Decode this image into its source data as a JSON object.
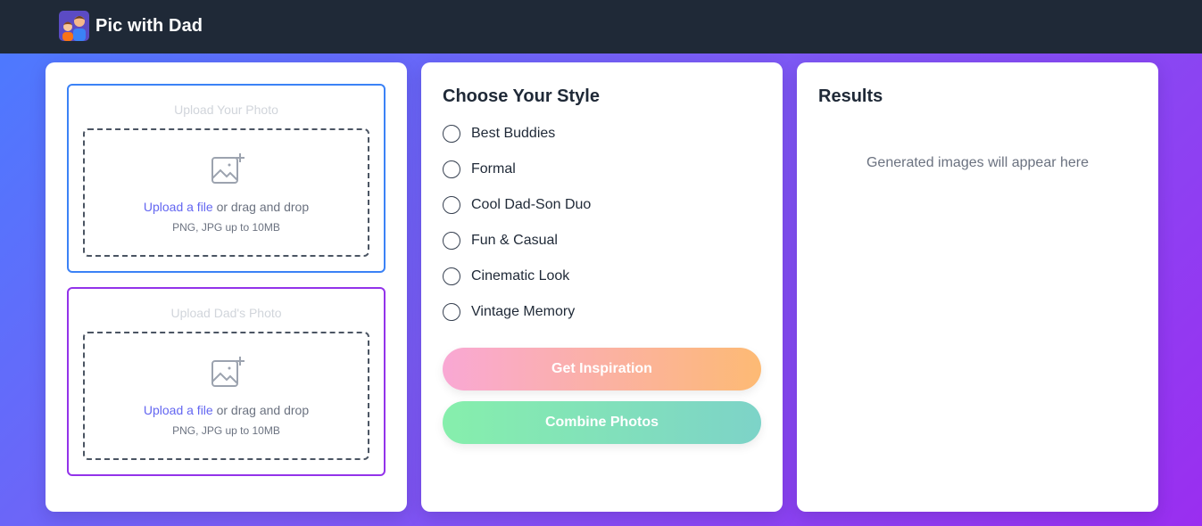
{
  "app": {
    "title": "Pic with Dad",
    "logo_icon": "dad-and-son-logo-icon"
  },
  "upload": {
    "your_photo": {
      "title": "Upload Your Photo",
      "link": "Upload a file",
      "text": " or drag and drop",
      "hint": "PNG, JPG up to 10MB",
      "icon": "image-add-icon",
      "border_color": "#3b82f6"
    },
    "dad_photo": {
      "title": "Upload Dad's Photo",
      "link": "Upload a file",
      "text": " or drag and drop",
      "hint": "PNG, JPG up to 10MB",
      "icon": "image-add-icon",
      "border_color": "#9333ea"
    }
  },
  "style": {
    "title": "Choose Your Style",
    "options": [
      {
        "label": "Best Buddies",
        "selected": false
      },
      {
        "label": "Formal",
        "selected": false
      },
      {
        "label": "Cool Dad-Son Duo",
        "selected": false
      },
      {
        "label": "Fun & Casual",
        "selected": false
      },
      {
        "label": "Cinematic Look",
        "selected": false
      },
      {
        "label": "Vintage Memory",
        "selected": false
      }
    ],
    "inspire_button": "Get Inspiration",
    "combine_button": "Combine Photos"
  },
  "results": {
    "title": "Results",
    "empty_text": "Generated images will appear here"
  },
  "colors": {
    "topbar": "#1f2937",
    "accent_link": "#6366f1"
  }
}
